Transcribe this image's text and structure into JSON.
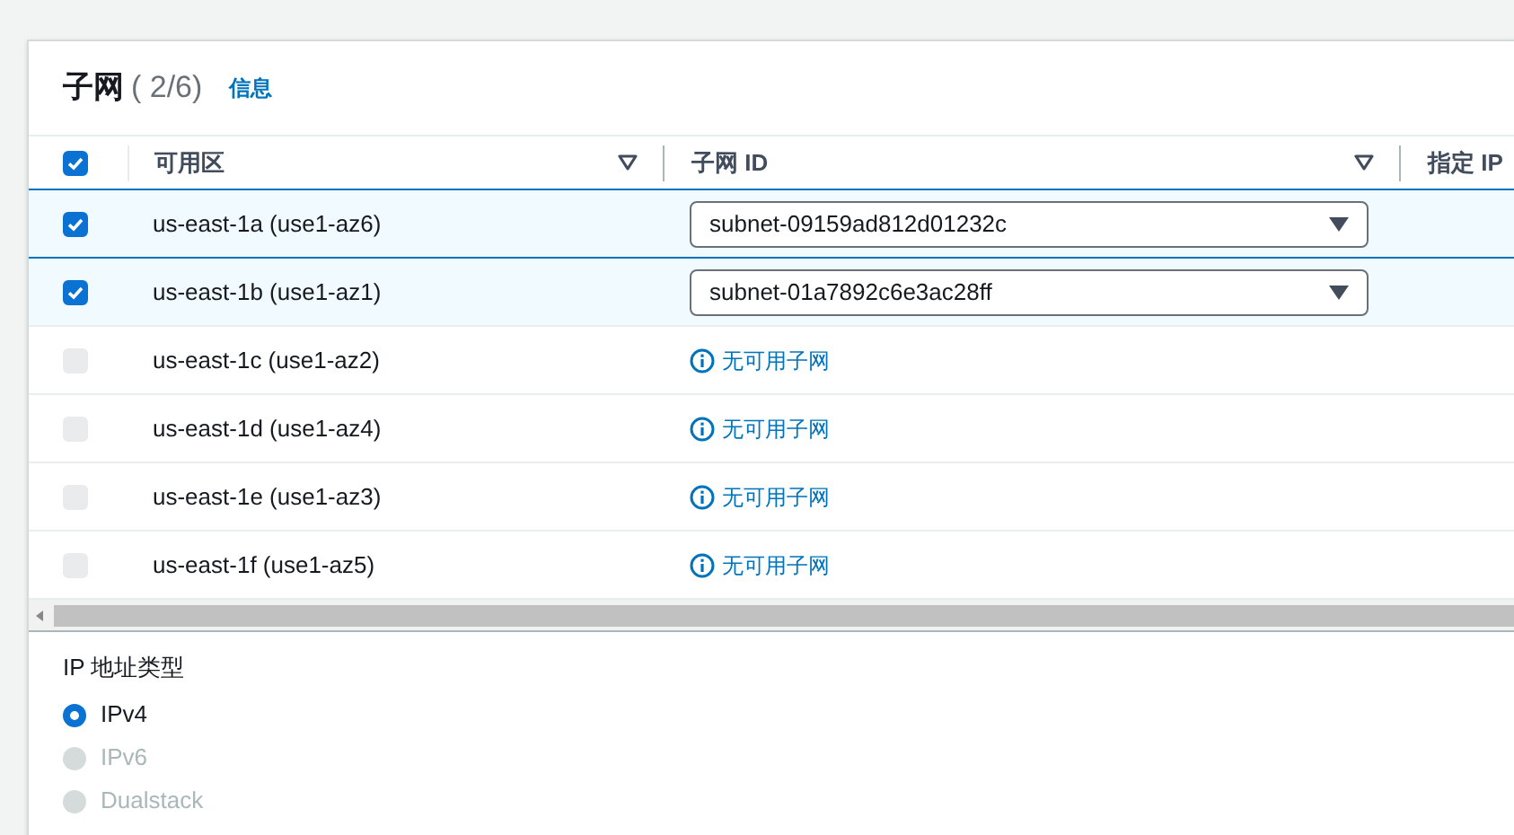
{
  "panel": {
    "title": "子网",
    "count": "( 2/6)",
    "info_link": "信息"
  },
  "table": {
    "header_checkbox": {
      "checked": true
    },
    "columns": [
      "可用区",
      "子网 ID",
      "指定 IP"
    ],
    "rows": [
      {
        "checked": true,
        "disabled": false,
        "zone": "us-east-1a (use1-az6)",
        "subnet": {
          "kind": "select",
          "value": "subnet-09159ad812d01232c"
        }
      },
      {
        "checked": true,
        "disabled": false,
        "zone": "us-east-1b (use1-az1)",
        "subnet": {
          "kind": "select",
          "value": "subnet-01a7892c6e3ac28ff"
        }
      },
      {
        "checked": false,
        "disabled": true,
        "zone": "us-east-1c (use1-az2)",
        "subnet": {
          "kind": "unavailable",
          "value": "无可用子网"
        }
      },
      {
        "checked": false,
        "disabled": true,
        "zone": "us-east-1d (use1-az4)",
        "subnet": {
          "kind": "unavailable",
          "value": "无可用子网"
        }
      },
      {
        "checked": false,
        "disabled": true,
        "zone": "us-east-1e (use1-az3)",
        "subnet": {
          "kind": "unavailable",
          "value": "无可用子网"
        }
      },
      {
        "checked": false,
        "disabled": true,
        "zone": "us-east-1f (use1-az5)",
        "subnet": {
          "kind": "unavailable",
          "value": "无可用子网"
        }
      }
    ]
  },
  "ip_address_type": {
    "label": "IP 地址类型",
    "options": [
      {
        "label": "IPv4",
        "selected": true,
        "disabled": false
      },
      {
        "label": "IPv6",
        "selected": false,
        "disabled": true
      },
      {
        "label": "Dualstack",
        "selected": false,
        "disabled": true
      }
    ]
  }
}
